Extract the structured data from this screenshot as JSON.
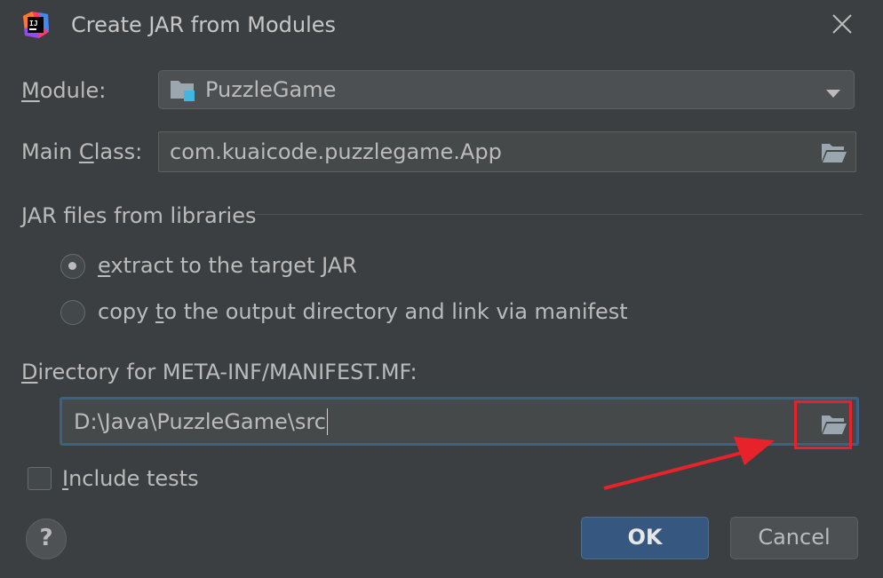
{
  "dialog": {
    "title": "Create JAR from Modules",
    "app_icon": "intellij-idea-icon",
    "close_icon": "close-icon"
  },
  "module": {
    "label_mnemonic": "M",
    "label_rest": "odule:",
    "value": "PuzzleGame",
    "icon": "module-folder-icon"
  },
  "main_class": {
    "label_pre": "Main ",
    "label_mnemonic": "C",
    "label_rest": "lass:",
    "value": "com.kuaicode.puzzlegame.App",
    "browse_icon": "folder-open-icon"
  },
  "libraries": {
    "section_title": "JAR files from libraries",
    "options": [
      {
        "mnemonic": "e",
        "rest": "xtract to the target JAR",
        "selected": true
      },
      {
        "pre": "copy ",
        "mnemonic": "t",
        "rest": "o the output directory and link via manifest",
        "selected": false
      }
    ]
  },
  "manifest_dir": {
    "label_mnemonic": "D",
    "label_rest": "irectory for META-INF/MANIFEST.MF:",
    "value": "D:\\Java\\PuzzleGame\\src",
    "browse_icon": "folder-open-icon"
  },
  "include_tests": {
    "mnemonic": "I",
    "rest": "nclude tests",
    "checked": false
  },
  "buttons": {
    "help": "?",
    "ok": "OK",
    "cancel": "Cancel"
  },
  "annotation": {
    "color": "#e8222a"
  }
}
